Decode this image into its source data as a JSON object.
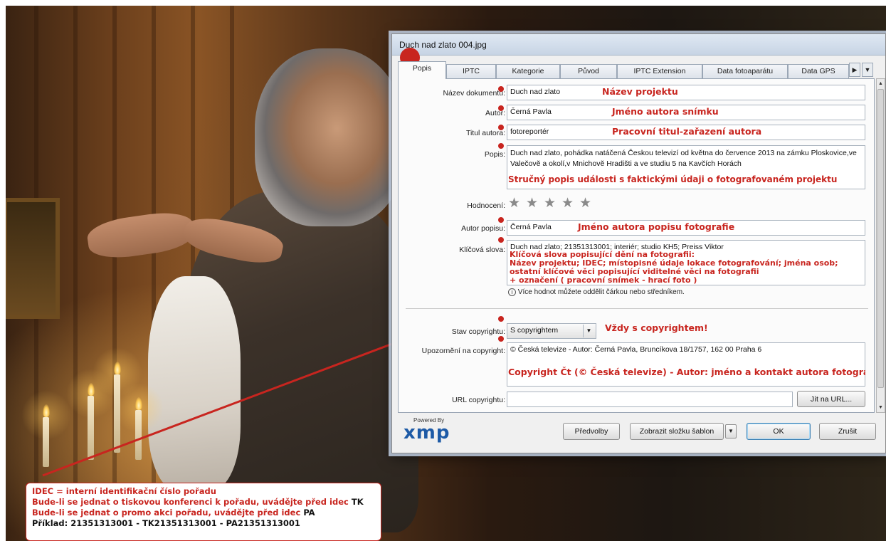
{
  "dialog": {
    "title": "Duch nad zlato 004.jpg",
    "tabs": [
      "Popis",
      "IPTC",
      "Kategorie",
      "Původ",
      "IPTC Extension",
      "Data fotoaparátu",
      "Data GPS"
    ],
    "active_tab": "Popis",
    "fields": {
      "nazev_label": "Název dokumentu:",
      "nazev_value": "Duch nad zlato",
      "autor_label": "Autor:",
      "autor_value": "Černá Pavla",
      "titul_label": "Titul autora:",
      "titul_value": "fotoreportér",
      "popis_label": "Popis:",
      "popis_value": "Duch nad zlato, pohádka natáčená Českou televizí od května do července 2013 na zámku Ploskovice,ve Valečově a okolí,v Mnichově Hradišti a ve studiu 5 na Kavčích Horách",
      "hodnoceni_label": "Hodnocení:",
      "rating": 0,
      "rating_max": 5,
      "autor_popisu_label": "Autor popisu:",
      "autor_popisu_value": "Černá Pavla",
      "klicova_label": "Klíčová slova:",
      "klicova_value": "Duch nad zlato; 21351313001; interiér; studio KH5; Preiss Viktor",
      "info_hint": "Více hodnot můžete oddělit čárkou nebo středníkem.",
      "stav_label": "Stav copyrightu:",
      "stav_value": "S copyrightem",
      "upozorneni_label": "Upozornění na copyright:",
      "upozorneni_value": "© Česká televize - Autor: Černá Pavla, Bruncíkova 18/1757, 162 00 Praha 6",
      "url_label": "URL copyrightu:",
      "url_value": "",
      "url_button": "Jít na URL..."
    },
    "footer": {
      "powered_by": "Powered By",
      "xmp_logo": "xmp",
      "predvolby": "Předvolby",
      "zobrazit": "Zobrazit složku šablon",
      "ok": "OK",
      "zrusit": "Zrušit"
    }
  },
  "annotations": {
    "nazev": "Název projektu",
    "autor": "Jméno autora snímku",
    "titul": "Pracovní titul-zařazení autora",
    "popis": "Stručný popis události s faktickými údaji o fotografovaném projektu",
    "autor_popisu": "Jméno autora popisu fotografie",
    "klicova_1": "Klíčová slova popisující dění na fotografii:",
    "klicova_2": "Název projektu; IDEC; místopisné údaje lokace fotografování; jména osob;",
    "klicova_3": "ostatní klíčové věci popisující viditelné věci na fotografii",
    "klicova_4": "+ označení ( pracovní snímek - hrací foto )",
    "stav": "Vždy s copyrightem!",
    "upozorneni": "Copyright Čt (© Česká televize) - Autor: jméno a kontakt autora fotografie"
  },
  "idec_note": {
    "line1": "IDEC = interní identifikační číslo pořadu",
    "line2_red": "Bude-li se jednat o tiskovou konferenci k pořadu, uvádějte před idec",
    "line2_blk": "TK",
    "line3_red": "Bude-li se jednat o promo akci pořadu, uvádějte před idec",
    "line3_blk": "PA",
    "line4": "Příklad: 21351313001 - TK21351313001 - PA21351313001"
  },
  "colors": {
    "annotation_red": "#c8251f",
    "dialog_bg": "#f0f0f0",
    "xmp_blue": "#1d5aa6"
  }
}
